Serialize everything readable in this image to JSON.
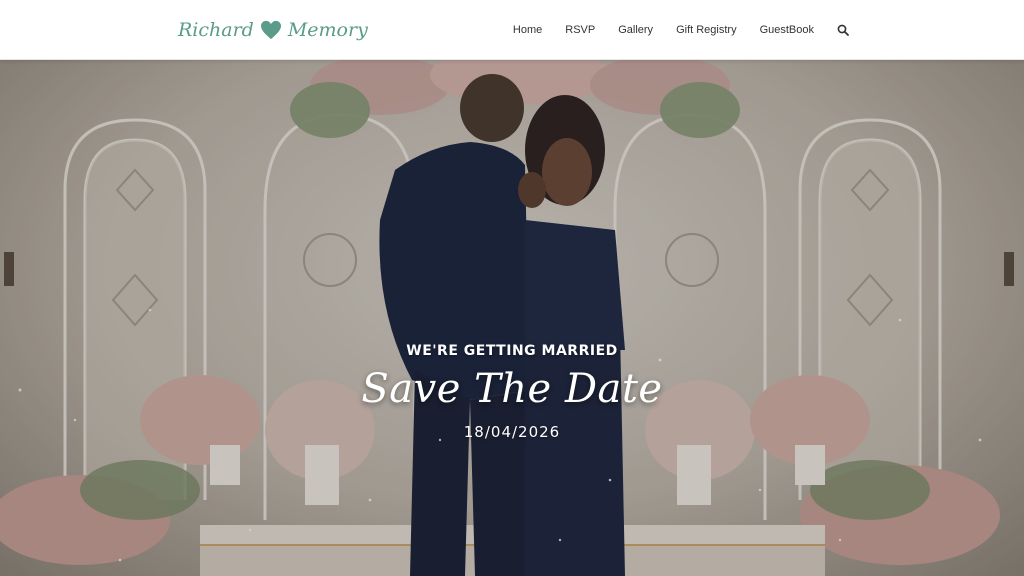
{
  "header": {
    "logo": {
      "left_name": "Richard",
      "right_name": "Memory",
      "heart_color": "#5a9b8a"
    },
    "nav": [
      "Home",
      "RSVP",
      "Gallery",
      "Gift Registry",
      "GuestBook"
    ],
    "search_icon": "search-icon"
  },
  "hero": {
    "kicker": "WE'RE GETTING MARRIED",
    "headline": "Save The Date",
    "date": "18/04/2026"
  },
  "colors": {
    "brand": "#5a9b8a",
    "nav_text": "#333333",
    "hero_text": "#ffffff",
    "suit": "#1c2540"
  }
}
